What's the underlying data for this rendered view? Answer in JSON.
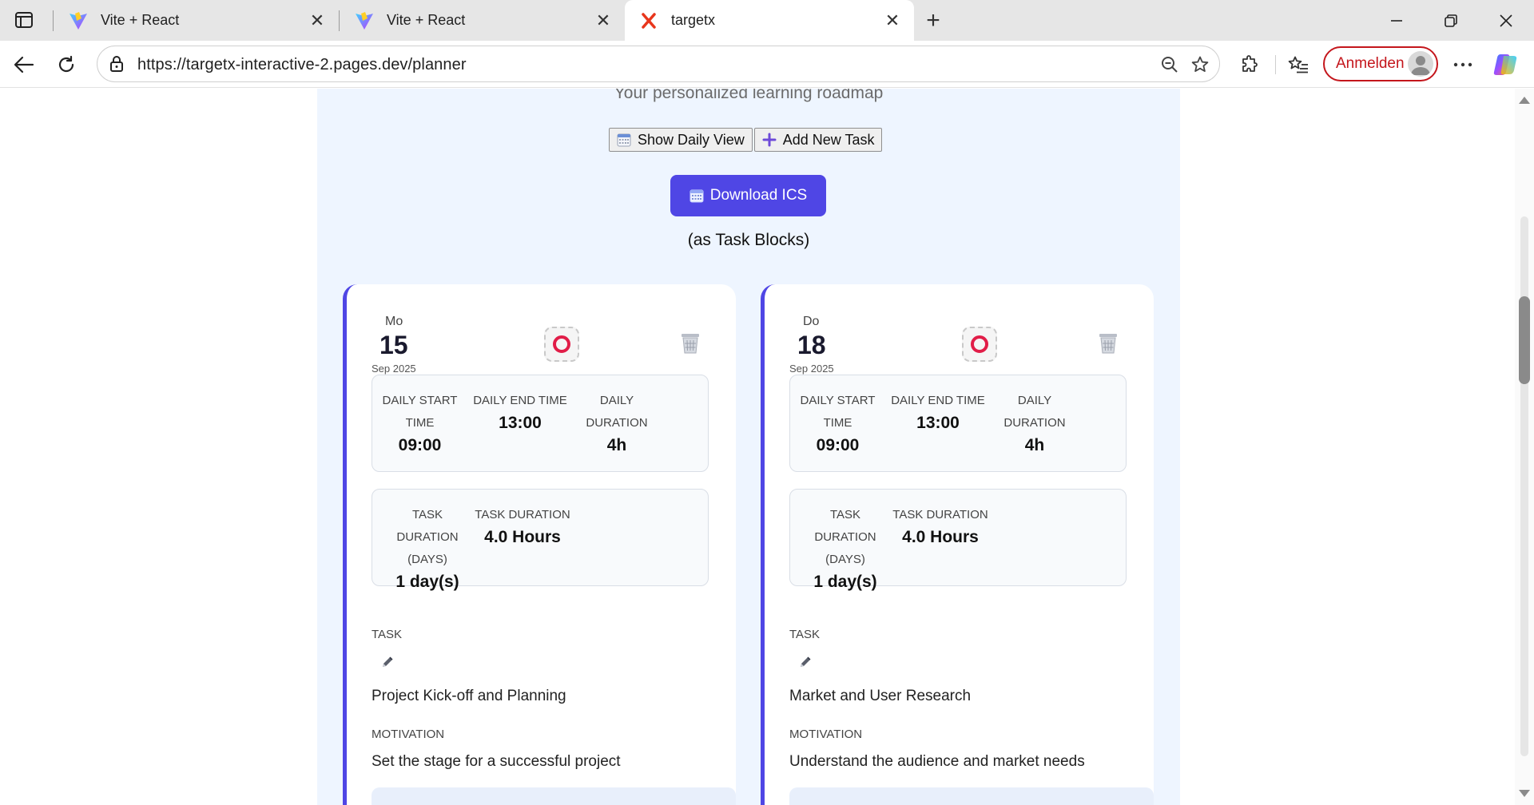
{
  "browser": {
    "tabs": [
      {
        "title": "Vite + React",
        "icon": "vite-icon",
        "active": false
      },
      {
        "title": "Vite + React",
        "icon": "vite-icon",
        "active": false
      },
      {
        "title": "targetx",
        "icon": "targetx-x-icon",
        "active": true
      }
    ],
    "url": "https://targetx-interactive-2.pages.dev/planner",
    "signin_label": "Anmelden",
    "colors": {
      "signin_accent": "#c4161c",
      "tab_bar": "#e6e6e6"
    }
  },
  "page": {
    "subtitle": "Your personalized learning roadmap",
    "show_daily_view_label": "Show Daily View",
    "add_new_task_label": "Add New Task",
    "download_ics_label": "Download ICS",
    "task_blocks_note": "(as Task Blocks)",
    "colors": {
      "accent": "#4f46e5",
      "background": "#eef5ff",
      "status": "#e11d48"
    }
  },
  "labels": {
    "daily_start_time": [
      "DAILY START",
      "TIME"
    ],
    "daily_end_time": "DAILY END TIME",
    "daily_duration": [
      "DAILY",
      "DURATION"
    ],
    "task_duration_days": [
      "TASK DURATION",
      "(DAYS)"
    ],
    "task_duration_hours": "TASK DURATION",
    "task": "TASK",
    "motivation": "MOTIVATION"
  },
  "cards": [
    {
      "day_of_week": "Mo",
      "day": "15",
      "month_year": "Sep 2025",
      "daily_start": "09:00",
      "daily_end": "13:00",
      "daily_duration": "4h",
      "task_days": "1 day(s)",
      "task_hours": "4.0 Hours",
      "task": "Project Kick-off and Planning",
      "motivation": "Set the stage for a successful project"
    },
    {
      "day_of_week": "Do",
      "day": "18",
      "month_year": "Sep 2025",
      "daily_start": "09:00",
      "daily_end": "13:00",
      "daily_duration": "4h",
      "task_days": "1 day(s)",
      "task_hours": "4.0 Hours",
      "task": "Market and User Research",
      "motivation": "Understand the audience and market needs"
    }
  ]
}
